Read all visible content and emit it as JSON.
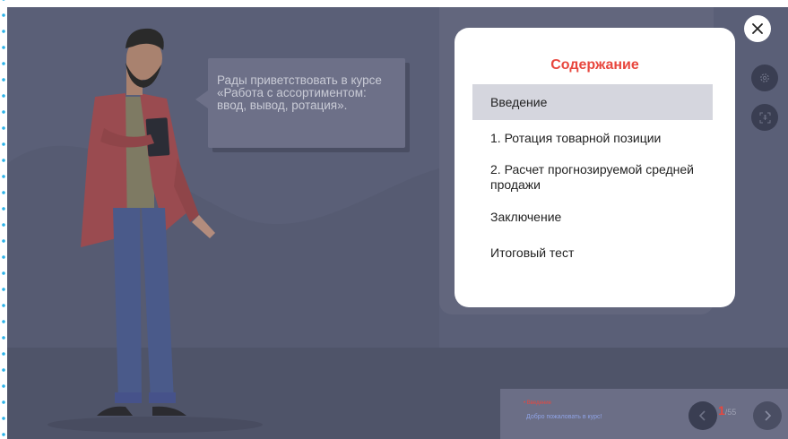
{
  "speech_bubble": {
    "text": "Рады приветствовать в курсе «Работа с ассортиментом: ввод, вывод, ротация»."
  },
  "toc_modal": {
    "title": "Содержание",
    "items": [
      {
        "label": "Введение",
        "active": true
      },
      {
        "label": "1. Ротация товарной позиции",
        "active": false
      },
      {
        "label": "2. Расчет прогнозируемой средней продажи",
        "active": false
      },
      {
        "label": "Заключение",
        "active": false
      },
      {
        "label": "Итоговый тест",
        "active": false
      }
    ]
  },
  "controls": {
    "close_icon": "close-icon",
    "settings_icon": "gear-icon",
    "accessibility_icon": "accessibility-icon",
    "prev_icon": "chevron-left-icon",
    "next_icon": "chevron-right-icon"
  },
  "footer": {
    "section_label": "• Введение",
    "slide_title": "Добро пожаловать в курс!",
    "current_page": "1",
    "total_pages": "/55"
  },
  "colors": {
    "accent": "#e8473e",
    "overlay": "#5a5f77",
    "modal_active_row": "#d5d6de",
    "dots": "#2db3e8"
  }
}
